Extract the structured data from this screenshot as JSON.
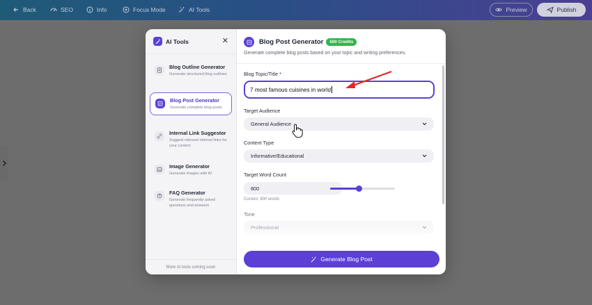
{
  "topbar": {
    "back": "Back",
    "seo": "SEO",
    "info": "Info",
    "focus": "Focus Mode",
    "ai_tools": "AI Tools",
    "preview": "Preview",
    "publish": "Publish"
  },
  "sidebar": {
    "title": "AI Tools",
    "items": [
      {
        "name": "Blog Outline Generator",
        "desc": "Generate structured blog outlines"
      },
      {
        "name": "Blog Post Generator",
        "desc": "Generate complete blog posts"
      },
      {
        "name": "Internal Link Suggestor",
        "desc": "Suggest relevant internal links for your content"
      },
      {
        "name": "Image Generator",
        "desc": "Generate images with AI"
      },
      {
        "name": "FAQ Generator",
        "desc": "Generate frequently asked questions and answers"
      }
    ],
    "footer": "More AI tools coming soon"
  },
  "main": {
    "title": "Blog Post Generator",
    "badge": "500 Credits",
    "subtitle": "Generate complete blog posts based on your topic and writing preferences.",
    "topic_label": "Blog Topic/Title *",
    "topic_value": "7 most famous cuisines in world",
    "audience_label": "Target Audience",
    "audience_value": "General Audience",
    "content_type_label": "Content Type",
    "content_type_value": "Informative/Educational",
    "word_count_label": "Target Word Count",
    "word_count_value": "800",
    "word_count_hint": "Current: 800 words",
    "word_count_slider_fraction": 0.45,
    "tone_label": "Tone",
    "tone_value": "Professional",
    "generate_label": "Generate Blog Post"
  },
  "colors": {
    "accent": "#5b3fd6",
    "badge": "#2fb64a",
    "annotation_arrow": "#e3262a"
  },
  "icons": [
    "back-arrow-icon",
    "seo-icon",
    "info-icon",
    "focus-icon",
    "wand-icon",
    "eye-icon",
    "send-icon",
    "close-icon",
    "chevron-down-icon",
    "hand-cursor-icon"
  ]
}
